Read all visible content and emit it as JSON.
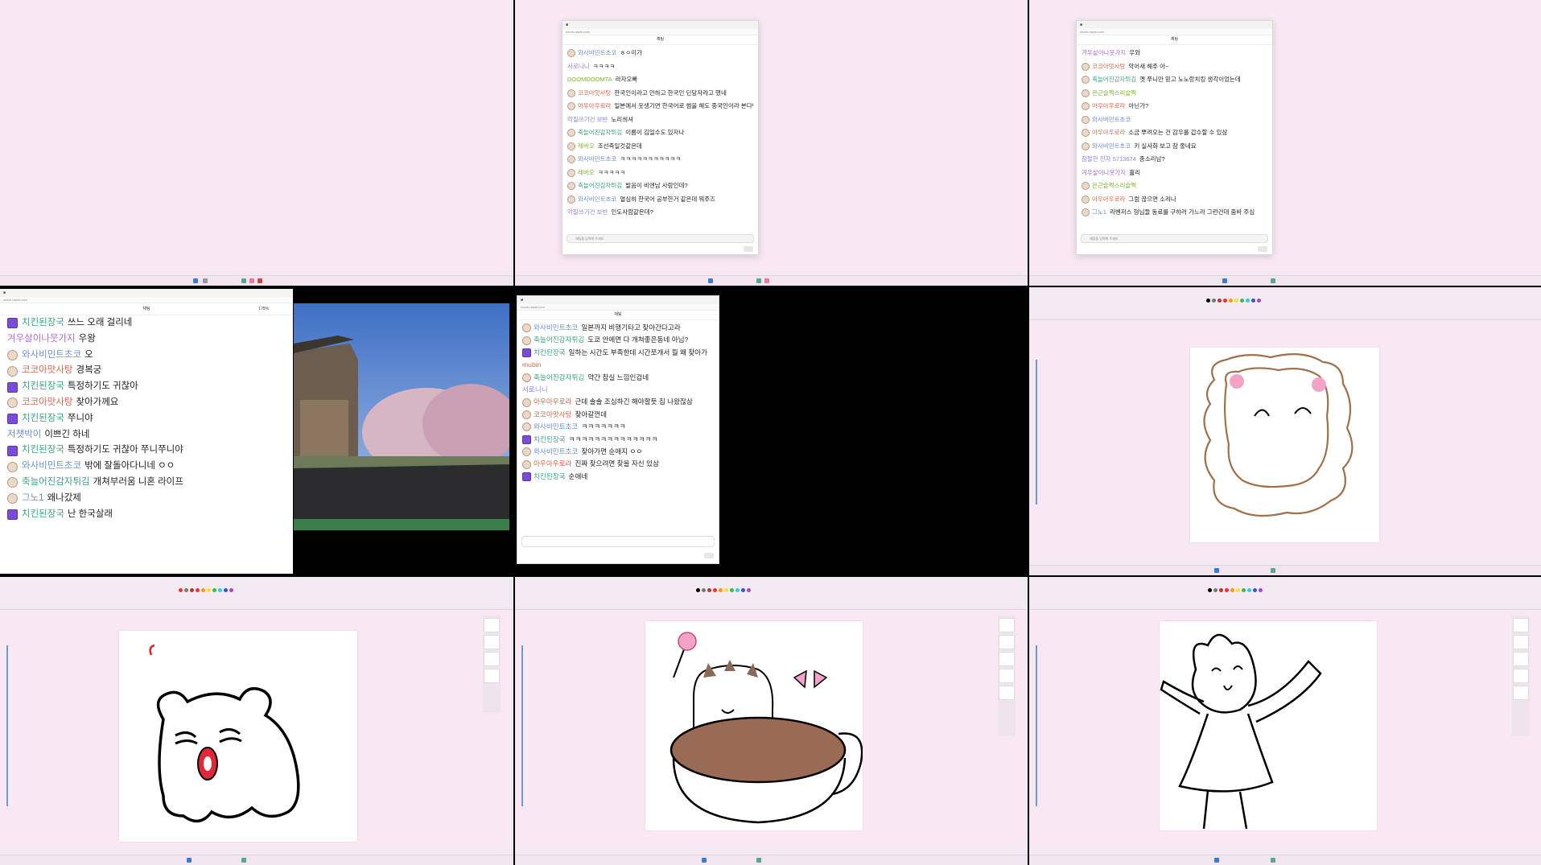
{
  "chat_header": "채팅",
  "chat_placeholder": "채팅을 입력해 주세요",
  "zoom_large": "175%",
  "window1": {
    "messages": [
      {
        "nick": "와사비민트초코",
        "text": "ㅎㅇ이가",
        "color": "n1",
        "badge": "avatar"
      },
      {
        "nick": "서로니니",
        "text": "ㅋㅋㅋㅋ",
        "color": "n6",
        "badge": "none"
      },
      {
        "nick": "DOOMDOOMTA",
        "text": "라자오빠",
        "color": "n5",
        "badge": "none"
      },
      {
        "nick": "코코아맛사탕",
        "text": "한국인이라고 안하고 한국인 딘당자라고 했네",
        "color": "n3",
        "badge": "avatar"
      },
      {
        "nick": "아우아우로라",
        "text": "일본에서 웃생기면 한국어로 썸을 해도 중국인이라 본다던데 진짜임?",
        "color": "n3",
        "badge": "avatar"
      },
      {
        "nick": "악질쓰기건 보반",
        "text": "노리씌셔",
        "color": "n6",
        "badge": "none"
      },
      {
        "nick": "축늘어진감자튀김",
        "text": "이름이 김일수도 있자나",
        "color": "n2",
        "badge": "avatar"
      },
      {
        "nick": "레바오",
        "text": "조선족일것같은데",
        "color": "n5",
        "badge": "avatar"
      },
      {
        "nick": "와사비민트초코",
        "text": "ㅋㅋㅋㅋㅋㅋㅋㅋㅋㅋㅋ",
        "color": "n1",
        "badge": "avatar"
      },
      {
        "nick": "레바오",
        "text": "ㅋㅋㅋㅋㅋ",
        "color": "n5",
        "badge": "avatar"
      },
      {
        "nick": "축늘어진감자튀김",
        "text": "발음이 비엔남 사람인데?",
        "color": "n2",
        "badge": "avatar"
      },
      {
        "nick": "와사비민트초코",
        "text": "열심히 한국어 공부한거 같은데 뭐주즈",
        "color": "n1",
        "badge": "avatar"
      },
      {
        "nick": "악질쓰기건 보반",
        "text": "인도사람같은데?",
        "color": "n6",
        "badge": "none"
      }
    ]
  },
  "window2": {
    "messages": [
      {
        "nick": "겨우살이나뭇가지",
        "text": "우와",
        "color": "n4",
        "badge": "none"
      },
      {
        "nick": "코코아맛사탕",
        "text": "악어새 해주 아~",
        "color": "n3",
        "badge": "avatar"
      },
      {
        "nick": "축늘어진감자튀김",
        "text": "옛 쭈니만 믿고 노노랑치킹 생각이었는데",
        "color": "n2",
        "badge": "avatar"
      },
      {
        "nick": "은근슬쩍스리슬쩍",
        "text": "",
        "color": "n5",
        "badge": "avatar"
      },
      {
        "nick": "아우아우로라",
        "text": "아닌가?",
        "color": "n3",
        "badge": "avatar"
      },
      {
        "nick": "와사비민트초코",
        "text": "",
        "color": "n1",
        "badge": "avatar"
      },
      {
        "nick": "아우아우로라",
        "text": "소금 뿌려오는 건 감우를 갑수할 수 있삼",
        "color": "n3",
        "badge": "avatar"
      },
      {
        "nick": "와사비민트초코",
        "text": "키 실사화 보고 참 좋네요",
        "color": "n1",
        "badge": "avatar"
      },
      {
        "nick": "참팔한 전자 5713674",
        "text": "종소리남?",
        "color": "n6",
        "badge": "none"
      },
      {
        "nick": "겨우살이나뭇가지",
        "text": "흘리",
        "color": "n4",
        "badge": "none"
      },
      {
        "nick": "은근슬쩍스리슬쩍",
        "text": "",
        "color": "n5",
        "badge": "avatar"
      },
      {
        "nick": "아우아우로라",
        "text": "그럼 끊으면 소리나",
        "color": "n3",
        "badge": "avatar"
      },
      {
        "nick": "그노1",
        "text": "리벤저스 형님들 동료를 구하러 가느라 그런건데 줌바 주심",
        "color": "n1",
        "badge": "avatar"
      }
    ]
  },
  "window3": {
    "messages": [
      {
        "nick": "치킨된장국",
        "text": "쓰느 오래 걸리네",
        "color": "n2",
        "badge": "heart"
      },
      {
        "nick": "겨우살이나뭇가지",
        "text": "우왕",
        "color": "n4",
        "badge": "none"
      },
      {
        "nick": "와사비민트초코",
        "text": "오",
        "color": "n1",
        "badge": "avatar"
      },
      {
        "nick": "코코아맛사탕",
        "text": "경복궁",
        "color": "n3",
        "badge": "avatar"
      },
      {
        "nick": "치킨된장국",
        "text": "특정하기도 귀찮아",
        "color": "n2",
        "badge": "heart"
      },
      {
        "nick": "코코아맛사탕",
        "text": "찾아가께요",
        "color": "n3",
        "badge": "avatar"
      },
      {
        "nick": "치킨된장국",
        "text": "쭈니야",
        "color": "n2",
        "badge": "heart"
      },
      {
        "nick": "저챗박이",
        "text": "이쁘긴 하네",
        "color": "n1",
        "badge": "none"
      },
      {
        "nick": "치킨된장국",
        "text": "특정하기도 귀찮아 쭈니쭈니야",
        "color": "n2",
        "badge": "heart"
      },
      {
        "nick": "와사비민트초코",
        "text": "밖에 잘돌아다니네 ㅇㅇ",
        "color": "n1",
        "badge": "avatar"
      },
      {
        "nick": "축늘어진감자튀김",
        "text": "개쳐부러움 니혼 라이프",
        "color": "n2",
        "badge": "avatar"
      },
      {
        "nick": "그노1",
        "text": "왜나갔제",
        "color": "n1",
        "badge": "avatar"
      },
      {
        "nick": "치킨된장국",
        "text": "난 한국살래",
        "color": "n2",
        "badge": "heart"
      }
    ]
  },
  "window4": {
    "messages": [
      {
        "nick": "와사비민트초코",
        "text": "일본까지 비행기타고 찾아간다고라",
        "color": "n1",
        "badge": "avatar"
      },
      {
        "nick": "축늘어진감자튀김",
        "text": "도쿄 안에면 다 개쳐좋은동네 아님?",
        "color": "n2",
        "badge": "avatar"
      },
      {
        "nick": "치킨된장국",
        "text": "일하는 시간도 부족한데 시간쪼개서 뭘 왜 찾아가",
        "color": "n2",
        "badge": "heart"
      },
      {
        "nick": "mubin",
        "text": "",
        "color": "n3",
        "badge": "none"
      },
      {
        "nick": "축늘어진감자튀김",
        "text": "약간 참실 느낌인겁네",
        "color": "n2",
        "badge": "avatar"
      },
      {
        "nick": "서로니니",
        "text": "",
        "color": "n6",
        "badge": "none"
      },
      {
        "nick": "아우아우로라",
        "text": "근데 솔솔 조심하긴 해야할듯 집 나왔잖삼",
        "color": "n3",
        "badge": "avatar"
      },
      {
        "nick": "코코아맛사탕",
        "text": "찾아갈껀데",
        "color": "n3",
        "badge": "avatar"
      },
      {
        "nick": "와사비민트초코",
        "text": "ㅋㅋㅋㅋㅋㅋㅋ",
        "color": "n1",
        "badge": "avatar"
      },
      {
        "nick": "치킨된장국",
        "text": "ㅋㅋㅋㅋㅋㅋㅋㅋㅋㅋㅋㅋㅋㅋ",
        "color": "n2",
        "badge": "heart"
      },
      {
        "nick": "와사비민트초코",
        "text": "찾아가면 순애지 ㅇㅇ",
        "color": "n1",
        "badge": "avatar"
      },
      {
        "nick": "아우아우로라",
        "text": "진짜 찾으려면 찾을 자신 있삼",
        "color": "n3",
        "badge": "avatar"
      },
      {
        "nick": "치킨된장국",
        "text": "순애네",
        "color": "n2",
        "badge": "heart"
      }
    ]
  },
  "colors": {
    "desktop": "#f8e8f3",
    "black": "#000000",
    "brown": "#a0704c",
    "pink": "#f4a3c8"
  }
}
